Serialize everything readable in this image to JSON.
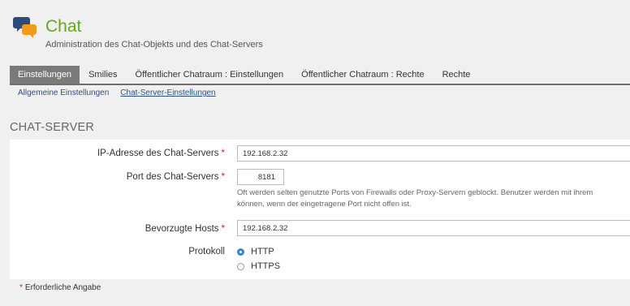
{
  "header": {
    "icon": "chat-bubbles-icon",
    "title": "Chat",
    "subtitle": "Administration des Chat-Objekts und des Chat-Servers"
  },
  "tabs": [
    {
      "label": "Einstellungen",
      "active": true
    },
    {
      "label": "Smilies",
      "active": false
    },
    {
      "label": "Öffentlicher Chatraum : Einstellungen",
      "active": false
    },
    {
      "label": "Öffentlicher Chatraum : Rechte",
      "active": false
    },
    {
      "label": "Rechte",
      "active": false
    }
  ],
  "subtabs": [
    {
      "label": "Allgemeine Einstellungen",
      "active": false
    },
    {
      "label": "Chat-Server-Einstellungen",
      "active": true
    }
  ],
  "section": {
    "title": "CHAT-SERVER"
  },
  "form": {
    "ip": {
      "label": "IP-Adresse des Chat-Servers",
      "value": "192.168.2.32",
      "required": "*"
    },
    "port": {
      "label": "Port des Chat-Servers",
      "value": "8181",
      "required": "*",
      "hint_line1": "Oft werden selten genutzte Ports von Firewalls oder Proxy-Servern geblockt. Benutzer werden mit ihrem",
      "hint_line2": "können, wenn der eingetragene Port nicht offen ist."
    },
    "hosts": {
      "label": "Bevorzugte Hosts",
      "value": "192.168.2.32",
      "required": "*"
    },
    "protocol": {
      "label": "Protokoll",
      "options": [
        {
          "label": "HTTP",
          "checked": true
        },
        {
          "label": "HTTPS",
          "checked": false
        }
      ]
    }
  },
  "footnote": {
    "marker": "*",
    "text": "Erforderliche Angabe"
  },
  "colors": {
    "title": "#6aa51e",
    "active_tab": "#7a7a7a",
    "required": "#cc2222",
    "radio_checked": "#3b80d6",
    "link": "#2f4f7f"
  }
}
